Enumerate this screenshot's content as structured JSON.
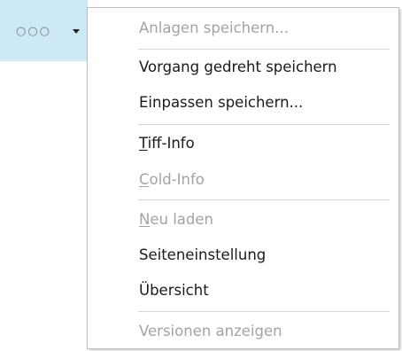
{
  "toolbar": {
    "more_glyph": "○○○",
    "dropdown_icon": "caret-down-icon"
  },
  "menu": {
    "items": [
      {
        "label": "Anlagen speichern...",
        "enabled": false
      },
      {
        "label": "Vorgang gedreht speichern",
        "enabled": true
      },
      {
        "label": "Einpassen speichern...",
        "enabled": true
      },
      {
        "mnemonic": "T",
        "rest": "iff-Info",
        "enabled": true
      },
      {
        "mnemonic": "C",
        "rest": "old-Info",
        "enabled": false
      },
      {
        "mnemonic": "N",
        "rest": "eu laden",
        "enabled": false
      },
      {
        "label": "Seiteneinstellung",
        "enabled": true
      },
      {
        "label": "Übersicht",
        "enabled": true
      },
      {
        "label": "Versionen anzeigen",
        "enabled": false
      }
    ]
  },
  "colors": {
    "highlight": "#cde8f6",
    "text": "#1a1a1a",
    "disabled_text": "#a3a3a3",
    "separator": "#d6d6d6",
    "border": "#bdbdbd"
  }
}
